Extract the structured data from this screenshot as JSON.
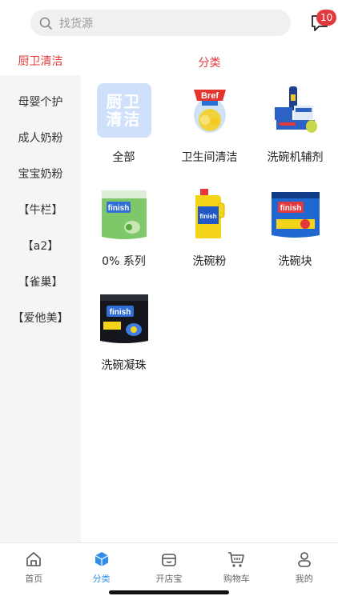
{
  "search": {
    "placeholder": "找货源"
  },
  "messages": {
    "badge_count": "10"
  },
  "sidebar": {
    "items": [
      {
        "label": "厨卫清洁",
        "active": true
      },
      {
        "label": "母婴个护"
      },
      {
        "label": "成人奶粉"
      },
      {
        "label": "宝宝奶粉"
      },
      {
        "label": "【牛栏】"
      },
      {
        "label": "【a2】"
      },
      {
        "label": "【雀巢】"
      },
      {
        "label": "【爱他美】"
      }
    ]
  },
  "main": {
    "section_title": "分类",
    "all_tile_text": "厨卫清洁",
    "tiles": [
      {
        "label": "全部",
        "icon": "category-all-icon"
      },
      {
        "label": "卫生间清洁",
        "icon": "toilet-cleaner-image"
      },
      {
        "label": "洗碗机辅剂",
        "icon": "dishwasher-additive-image"
      },
      {
        "label": "0% 系列",
        "icon": "finish-zero-pouch-image"
      },
      {
        "label": "洗碗粉",
        "icon": "finish-powder-bottle-image"
      },
      {
        "label": "洗碗块",
        "icon": "finish-powerball-image"
      },
      {
        "label": "洗碗凝珠",
        "icon": "finish-ultimate-pouch-image"
      }
    ]
  },
  "tabbar": {
    "items": [
      {
        "label": "首页",
        "icon": "home-icon"
      },
      {
        "label": "分类",
        "icon": "category-cube-icon",
        "active": true
      },
      {
        "label": "开店宝",
        "icon": "shop-icon"
      },
      {
        "label": "购物车",
        "icon": "cart-icon"
      },
      {
        "label": "我的",
        "icon": "user-icon"
      }
    ]
  },
  "colors": {
    "accent_red": "#e4393c",
    "accent_blue": "#2f8ee8",
    "all_tile_bg": "#cfe0fb"
  }
}
